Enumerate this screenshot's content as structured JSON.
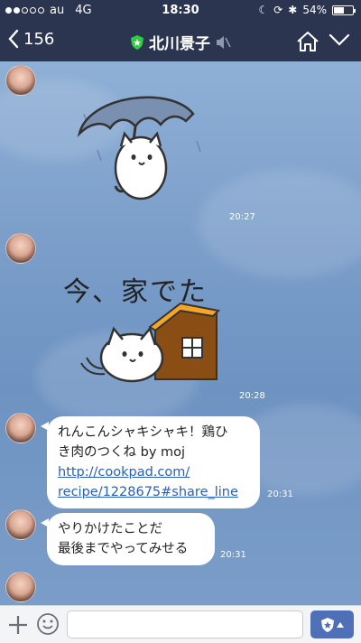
{
  "status_bar": {
    "carrier": "au",
    "network": "4G",
    "time": "18:30",
    "battery": "54%",
    "battery_level": 0.54
  },
  "header": {
    "back_count": "156",
    "contact_name": "北川景子",
    "official_badge_color": "#2ecc40"
  },
  "messages": [
    {
      "type": "sticker",
      "sticker_icon": "cat-umbrella-rain-sticker",
      "time": "20:27"
    },
    {
      "type": "sticker",
      "sticker_text": "今、家でた",
      "sticker_icon": "cat-leaving-house-sticker",
      "time": "20:28"
    },
    {
      "type": "text",
      "line1": "れんこんシャキシャキ！鶏ひ",
      "line2": "き肉のつくね by moj",
      "link1": "http://cookpad.com/",
      "link2": "recipe/1228675#share_line",
      "time": "20:31"
    },
    {
      "type": "text",
      "line1": "やりかけたことだ",
      "line2": "最後までやってみせる",
      "time": "20:31"
    }
  ],
  "input": {
    "placeholder": "",
    "value": ""
  },
  "colors": {
    "header_bg": "#2c3550",
    "accent": "#4f6fb6",
    "link": "#2a60b8"
  }
}
